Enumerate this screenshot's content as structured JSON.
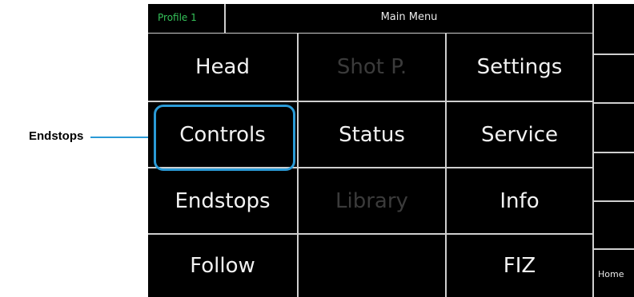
{
  "callout": {
    "label": "Endstops"
  },
  "topbar": {
    "profile": "Profile 1",
    "title": "Main Menu"
  },
  "menu": {
    "head": "Head",
    "shot_p": "Shot P.",
    "settings": "Settings",
    "controls": "Controls",
    "status": "Status",
    "service": "Service",
    "endstops": "Endstops",
    "library": "Library",
    "info": "Info",
    "follow": "Follow",
    "fiz": "FIZ"
  },
  "sidepanel": {
    "home": "Home"
  },
  "colors": {
    "accent": "#2a9ad6",
    "profile": "#35c35a",
    "background": "#000000",
    "disabled": "#3b3b3b"
  }
}
